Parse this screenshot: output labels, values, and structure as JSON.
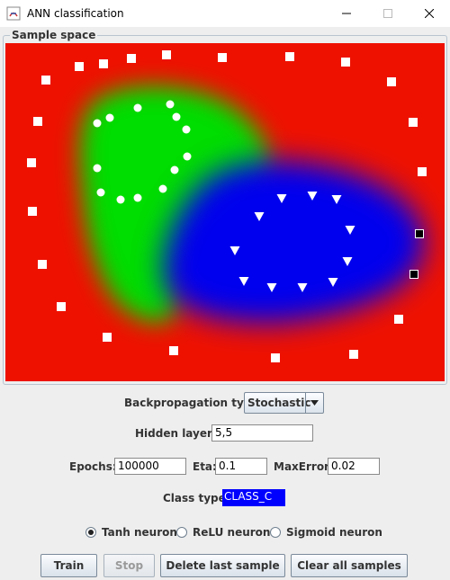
{
  "window": {
    "title": "ANN classification",
    "icons": {
      "app": "java-icon",
      "minimize": "minimize-icon",
      "maximize": "maximize-icon",
      "close": "close-icon"
    }
  },
  "sample_space": {
    "label": "Sample space",
    "colors": {
      "class_a": "#ee1100",
      "class_b": "#00dd00",
      "class_c": "#0000ee"
    },
    "samples": {
      "squares": [
        [
          88,
          74
        ],
        [
          115,
          71
        ],
        [
          146,
          65
        ],
        [
          185,
          61
        ],
        [
          247,
          64
        ],
        [
          322,
          63
        ],
        [
          384,
          69
        ],
        [
          435,
          91
        ],
        [
          51,
          89
        ],
        [
          42,
          135
        ],
        [
          459,
          136
        ],
        [
          35,
          181
        ],
        [
          469,
          191
        ],
        [
          36,
          235
        ],
        [
          47,
          294
        ],
        [
          68,
          341
        ],
        [
          443,
          355
        ],
        [
          119,
          375
        ],
        [
          193,
          390
        ],
        [
          306,
          398
        ],
        [
          393,
          394
        ]
      ],
      "circles": [
        [
          108,
          137
        ],
        [
          122,
          131
        ],
        [
          153,
          120
        ],
        [
          189,
          116
        ],
        [
          196,
          130
        ],
        [
          207,
          144
        ],
        [
          208,
          174
        ],
        [
          194,
          189
        ],
        [
          181,
          210
        ],
        [
          153,
          220
        ],
        [
          134,
          222
        ],
        [
          112,
          214
        ],
        [
          108,
          187
        ]
      ],
      "triangles": [
        [
          313,
          221
        ],
        [
          347,
          218
        ],
        [
          374,
          222
        ],
        [
          288,
          241
        ],
        [
          389,
          256
        ],
        [
          261,
          279
        ],
        [
          386,
          291
        ],
        [
          271,
          313
        ],
        [
          302,
          320
        ],
        [
          336,
          320
        ],
        [
          370,
          314
        ]
      ],
      "selected": [
        [
          466,
          260
        ],
        [
          460,
          305
        ]
      ]
    }
  },
  "controls": {
    "backprop_label": "Backpropagation type:",
    "backprop_value": "Stochastic",
    "hidden_label": "Hidden layers:",
    "hidden_value": "5,5",
    "epochs_label": "Epochs:",
    "epochs_value": "100000",
    "eta_label": "Eta:",
    "eta_value": "0.1",
    "maxerror_label": "MaxError:",
    "maxerror_value": "0.02",
    "classtype_label": "Class type:",
    "classtype_value": "CLASS_C",
    "neurons": [
      {
        "label": "Tanh neuron",
        "selected": true
      },
      {
        "label": "ReLU neuron",
        "selected": false
      },
      {
        "label": "Sigmoid neuron",
        "selected": false
      }
    ]
  },
  "buttons": {
    "train": "Train",
    "stop": "Stop",
    "delete_last": "Delete last sample",
    "clear_all": "Clear all samples"
  }
}
